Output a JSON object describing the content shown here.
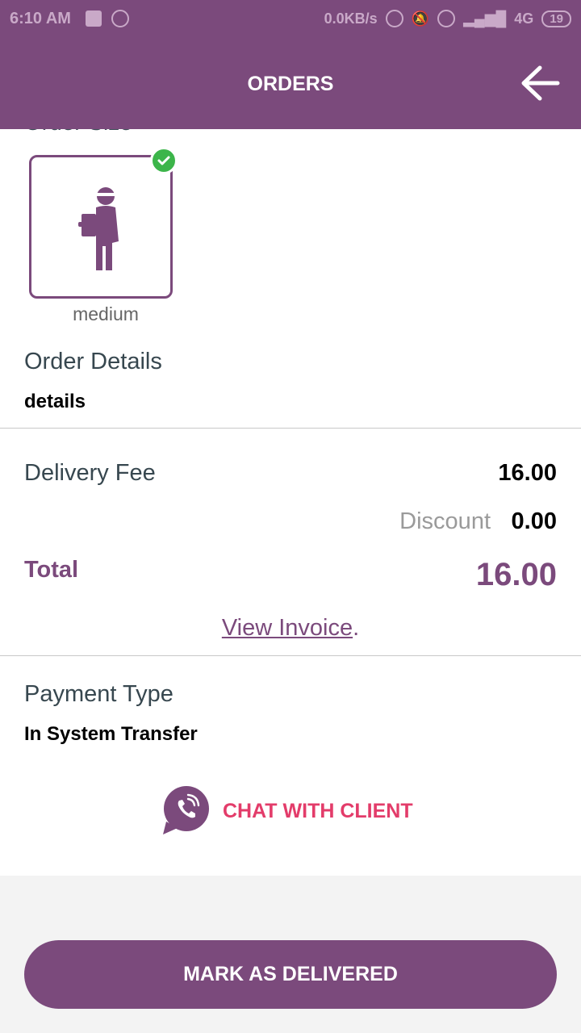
{
  "status_bar": {
    "time": "6:10 AM",
    "net_speed": "0.0KB/s",
    "network": "4G",
    "battery": "19",
    "icons": [
      "gallery-icon",
      "whatsapp-icon",
      "hotspot-icon",
      "mute-icon",
      "alarm-icon",
      "signal-icon",
      "volte-icon"
    ]
  },
  "app_bar": {
    "title": "ORDERS",
    "back_icon": "arrow-back-icon"
  },
  "order_size": {
    "heading_peek": "Order Size",
    "option_label": "medium",
    "selected": true,
    "icon": "delivery-person-icon"
  },
  "order_details": {
    "label": "Order Details",
    "value": "details"
  },
  "pricing": {
    "delivery_fee_label": "Delivery Fee",
    "delivery_fee_value": "16.00",
    "discount_label": "Discount",
    "discount_value": "0.00",
    "total_label": "Total",
    "total_value": "16.00",
    "invoice_link": "View Invoice",
    "invoice_suffix": "."
  },
  "payment": {
    "label": "Payment Type",
    "value": "In System Transfer"
  },
  "chat": {
    "label": "CHAT WITH CLIENT",
    "icon": "viber-call-icon"
  },
  "actions": {
    "mark_delivered": "MARK AS DELIVERED"
  },
  "colors": {
    "primary": "#7b4a7c",
    "accent": "#e33c6a",
    "check": "#3cb54a"
  }
}
